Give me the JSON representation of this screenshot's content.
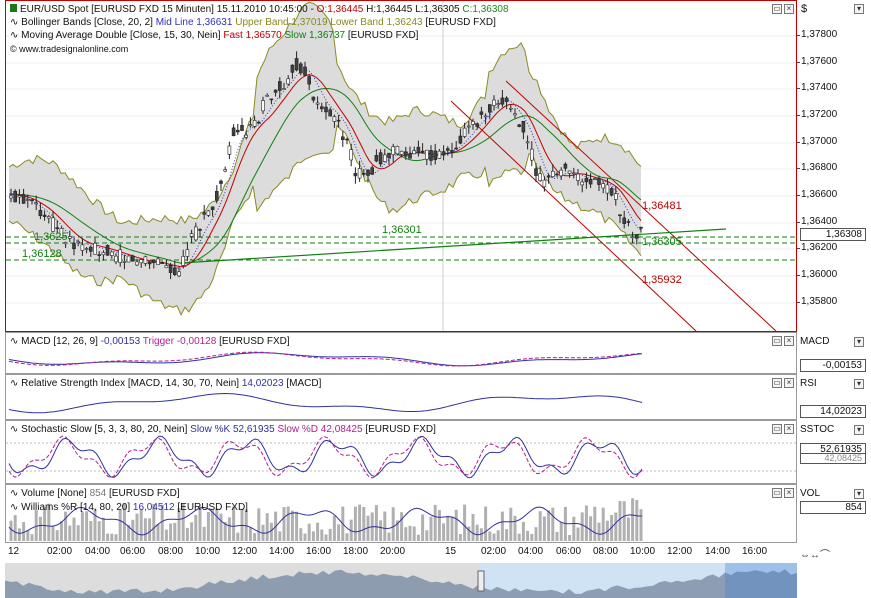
{
  "main": {
    "legend_line1": {
      "label": "EUR/USD Spot [EURUSD FXD  15 Minuten] 15.11.2010 10:45:00 -",
      "o": "O:1,36445",
      "h": "H:1,36445",
      "l": "L:1,36305",
      "c": "C:1,36308"
    },
    "legend_line2": {
      "label": "Bollinger Bands [Close, 20, 2]",
      "mid": "Mid Line 1,36631",
      "upper": "Upper Band 1,37019",
      "lower": "Lower Band 1,36243",
      "sym": "[EURUSD FXD]"
    },
    "legend_line3": {
      "label": "Moving Average Double [Close, 15, 30, Nein]",
      "fast": "Fast 1,36570",
      "slow": "Slow 1,36737",
      "sym": "[EURUSD FXD]"
    },
    "watermark": "www.tradesignalonline.com",
    "annotations": {
      "a1": "1,36301",
      "a2": "1,36481",
      "a3": "1,36305",
      "a4": "1,35932",
      "a5": "1,36128",
      "a6": "1,3625"
    },
    "currency": "$",
    "last_price": "1,36308",
    "price_ticks": [
      "1,37800",
      "1,37600",
      "1,37400",
      "1,37200",
      "1,37000",
      "1,36800",
      "1,36600",
      "1,36400",
      "1,36200",
      "1,36000",
      "1,35800"
    ]
  },
  "macd": {
    "legend": "MACD [12, 26, 9]",
    "v1": "-0,00153",
    "v2": "Trigger -0,00128",
    "sym": "[EURUSD FXD]",
    "scale_label": "MACD",
    "value": "-0,00153"
  },
  "rsi": {
    "legend": "Relative Strength Index [MACD, 14, 30, 70, Nein]",
    "v1": "14,02023",
    "sym": "[MACD]",
    "scale_label": "RSI",
    "value": "14,02023"
  },
  "stoch": {
    "legend": "Stochastic Slow [5, 3, 3, 80, 20, Nein]",
    "v1": "Slow %K 52,61935",
    "v2": "Slow %D 42,08425",
    "sym": "[EURUSD FXD]",
    "scale_label": "SSTOC",
    "value": "52,61935",
    "value2": "42,08425"
  },
  "vol": {
    "legend": "Volume [None]",
    "v1": "854",
    "sym": "[EURUSD FXD]",
    "legend2": "Williams %R [14, 80, 20]",
    "v2": "16,04512",
    "sym2": "[EURUSD FXD]",
    "scale_label": "VOL",
    "value": "854"
  },
  "time_labels": [
    "12",
    "02:00",
    "04:00",
    "06:00",
    "08:00",
    "10:00",
    "12:00",
    "14:00",
    "16:00",
    "18:00",
    "20:00",
    "15",
    "02:00",
    "04:00",
    "06:00",
    "08:00",
    "10:00",
    "12:00",
    "14:00",
    "16:00"
  ],
  "colors": {
    "candle_up": "#ffffff",
    "candle_down": "#404040",
    "bollinger": "#8a8a20",
    "mid": "#3030c0",
    "fast": "#c00000",
    "slow": "#108010",
    "channel": "#c00000",
    "trend": "#108010",
    "macd": "#3030a0",
    "trigger": "#b02090"
  }
}
